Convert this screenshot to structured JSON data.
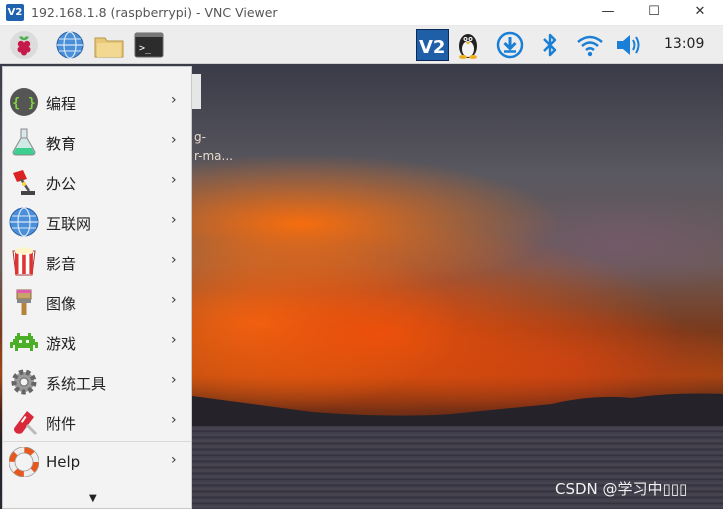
{
  "window": {
    "title": "192.168.1.8 (raspberrypi) - VNC Viewer",
    "logo": "V2",
    "minimize": "—",
    "maximize": "☐",
    "close": "✕"
  },
  "taskbar": {
    "launchers": [
      "raspberry-menu-icon",
      "web-browser-icon",
      "file-manager-icon",
      "terminal-icon"
    ],
    "tray": [
      "vnc-server-icon",
      "linux-penguin-icon",
      "download-icon",
      "bluetooth-icon",
      "wifi-icon",
      "volume-icon"
    ],
    "clock": "13:09",
    "terminal_glyph": ">_",
    "vnc_glyph": "V2"
  },
  "menu": {
    "items": [
      {
        "label": "编程",
        "icon": "programming-icon"
      },
      {
        "label": "教育",
        "icon": "education-icon"
      },
      {
        "label": "办公",
        "icon": "office-icon"
      },
      {
        "label": "互联网",
        "icon": "internet-icon"
      },
      {
        "label": "影音",
        "icon": "sound-video-icon"
      },
      {
        "label": "图像",
        "icon": "graphics-icon"
      },
      {
        "label": "游戏",
        "icon": "games-icon"
      },
      {
        "label": "系统工具",
        "icon": "system-tools-icon"
      },
      {
        "label": "附件",
        "icon": "accessories-icon"
      },
      {
        "label": "Help",
        "icon": "help-icon"
      }
    ],
    "arrow": "›",
    "scroll_down": "▼",
    "programming_glyph": "{ }"
  },
  "desktop": {
    "partial_text_1": "g-",
    "partial_text_2": "r-ma...",
    "watermark": "CSDN @学习中▯▯▯"
  },
  "colors": {
    "vnc_blue": "#1f63b0",
    "tray_blue": "#1a7fd6",
    "menu_bg": "#f3f3f3",
    "taskbar_bg": "#ededed"
  }
}
